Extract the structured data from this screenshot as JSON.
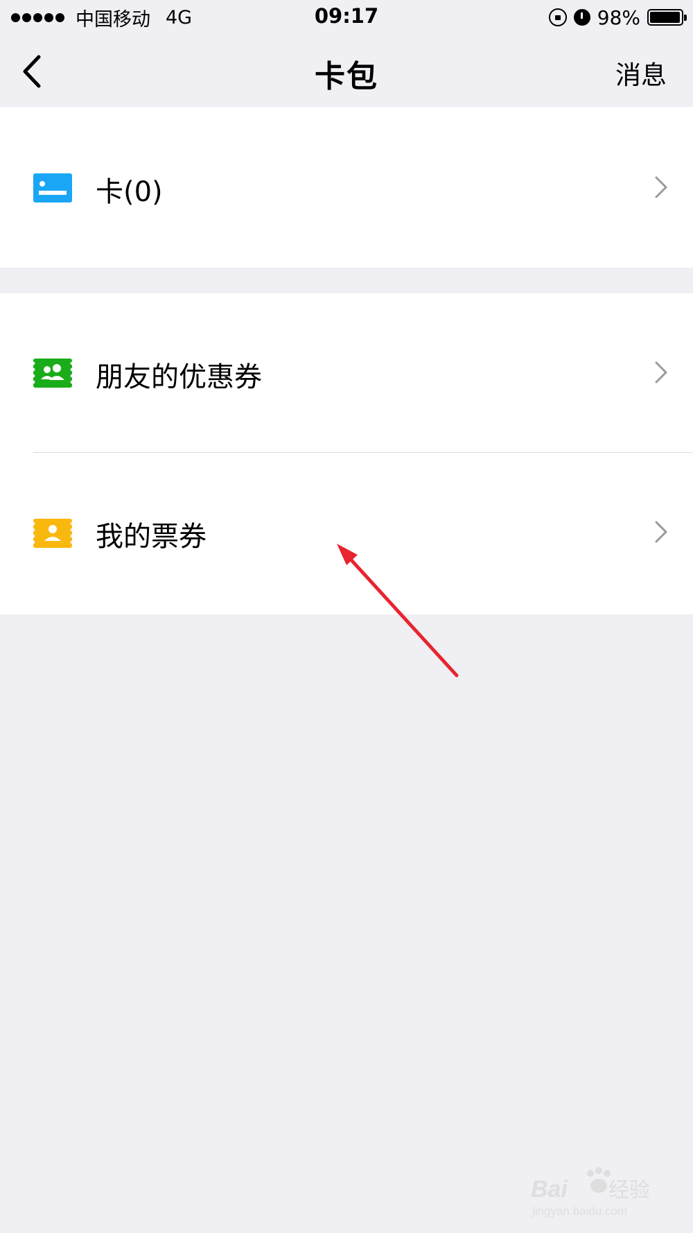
{
  "status_bar": {
    "carrier": "中国移动",
    "network": "4G",
    "time": "09:17",
    "battery": "98%",
    "battery_level": 0.98
  },
  "nav": {
    "title": "卡包",
    "action_label": "消息"
  },
  "items": [
    {
      "label": "卡(0)",
      "icon": "card-icon",
      "color": "#1aa6f5"
    },
    {
      "label": "朋友的优惠券",
      "icon": "friends-coupon-icon",
      "color": "#1aad19"
    },
    {
      "label": "我的票券",
      "icon": "ticket-icon",
      "color": "#f9b80d"
    }
  ],
  "colors": {
    "background": "#efeff4",
    "annotation_arrow": "#e8242f"
  },
  "watermark": {
    "brand": "Baidu经验",
    "url": "jingyan.baidu.com"
  }
}
